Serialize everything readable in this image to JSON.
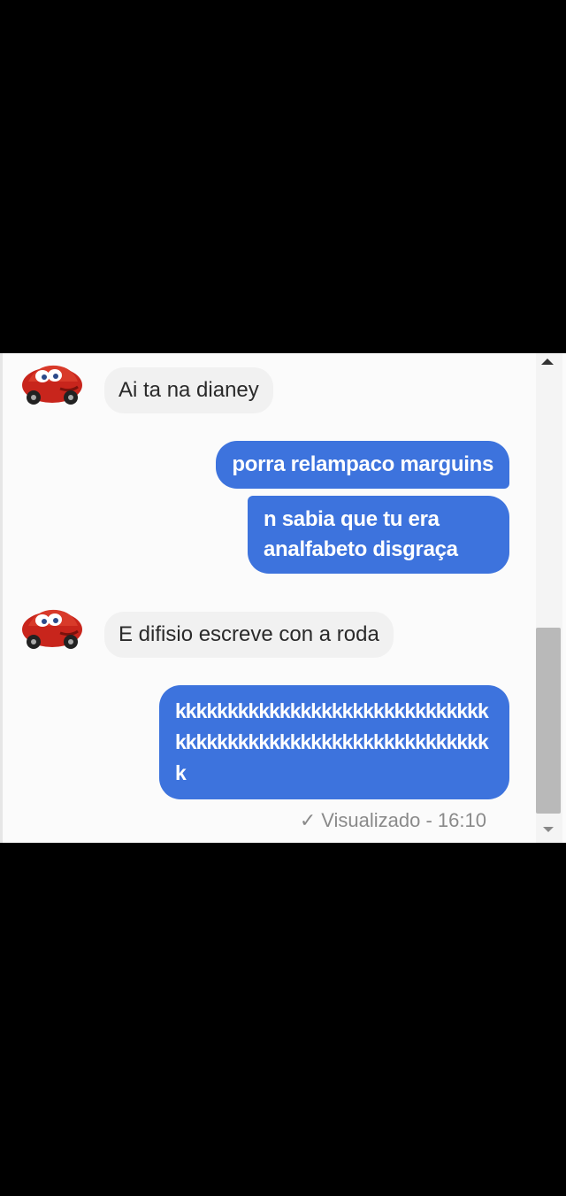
{
  "conversation": {
    "messages": [
      {
        "direction": "received",
        "text": "Ai ta na dianey",
        "avatar": "lightning-mcqueen-car-icon"
      },
      {
        "direction": "sent",
        "text": "porra relampaco marguins"
      },
      {
        "direction": "sent",
        "text": "n sabia que tu era analfabeto disgraça"
      },
      {
        "direction": "received",
        "text": "E difisio escreve con a roda",
        "avatar": "lightning-mcqueen-car-icon"
      },
      {
        "direction": "sent",
        "text": "kkkkkkkkkkkkkkkkkkkkkkkkkkkkkkkkkkkkkkkkkkkkkkkkkkkkkkkkkkkkk"
      }
    ],
    "seen_status": {
      "icon": "check-icon",
      "text": "Visualizado - 16:10"
    }
  },
  "colors": {
    "sent_bubble": "#3d73dd",
    "received_bubble": "#f1f1f1",
    "background": "#000000",
    "chat_background": "#fbfbfb"
  }
}
